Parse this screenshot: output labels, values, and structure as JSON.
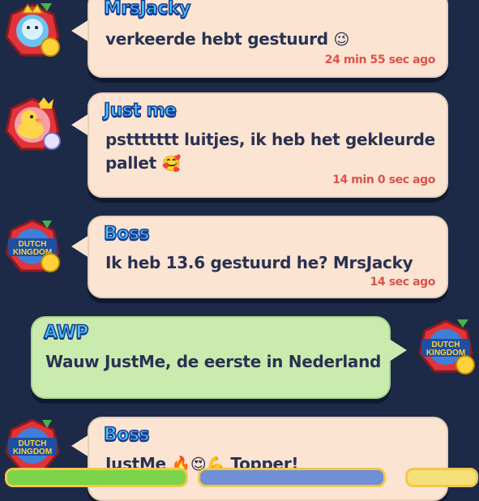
{
  "messages": [
    {
      "sender": "MrsJacky",
      "text": "verkeerde hebt gestuurd",
      "emoji": "😉",
      "time": "24 min 55 sec ago",
      "avatar": "fox-king-avatar"
    },
    {
      "sender": "Just me",
      "text_line1": "psttttttt luitjes, ik heb het gekleurde",
      "text_line2": "pallet",
      "emoji": "🥰",
      "time": "14 min 0 sec ago",
      "avatar": "rubber-duck-avatar"
    },
    {
      "sender": "Boss",
      "text": "Ik heb 13.6 gestuurd he? MrsJacky",
      "time": "14 sec ago",
      "avatar": "dutch-kingdom-avatar",
      "avatar_text": [
        "DUTCH",
        "KINGDOM"
      ]
    },
    {
      "sender": "AWP",
      "text": "Wauw JustMe, de eerste in Nederland",
      "avatar": "dutch-kingdom-avatar",
      "avatar_text": [
        "DUTCH",
        "KINGDOM"
      ]
    },
    {
      "sender": "Boss",
      "text": "JustMe",
      "emojis": "🔥😍💪",
      "text_after": "Topper!",
      "avatar": "dutch-kingdom-avatar",
      "avatar_text": [
        "DUTCH",
        "KINGDOM"
      ]
    }
  ],
  "colors": {
    "background": "#1c2a47",
    "bubble_other": "#fbe4d2",
    "bubble_self": "#c9ecae",
    "name": "#4fc3ff",
    "time": "#d9544a"
  }
}
